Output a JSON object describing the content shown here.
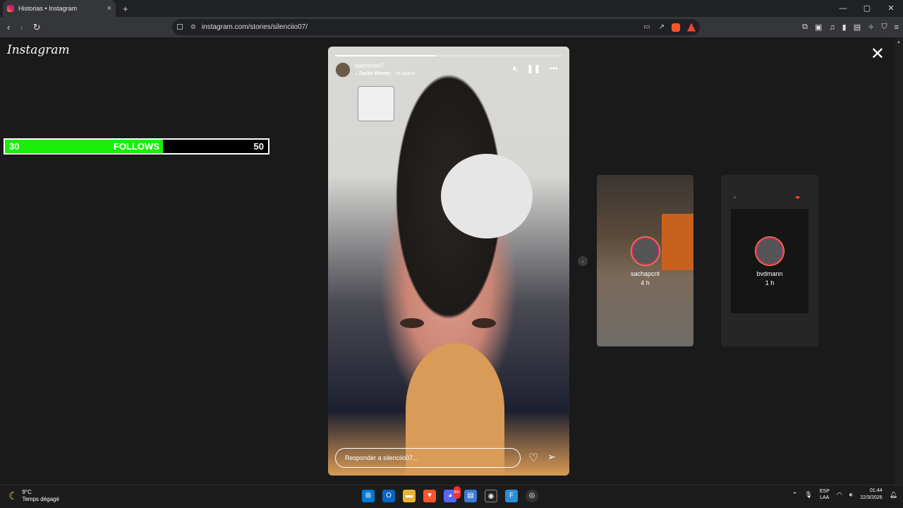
{
  "browser": {
    "tab_title": "Historias • Instagram",
    "tab_close": "×",
    "new_tab": "+",
    "window_controls": [
      "—",
      "▢",
      "✕"
    ],
    "url": "instagram.com/stories/silenciio07/",
    "nav_icons": [
      "back-icon",
      "forward-icon",
      "reload-icon"
    ]
  },
  "page": {
    "logo": "Instagram",
    "close": "✕"
  },
  "follows_bar": {
    "current": "30",
    "label": "FOLLOWS",
    "goal": "50",
    "progress_fraction": 0.6,
    "fill_color": "#18f00a"
  },
  "story": {
    "username": "silenciio07",
    "time": "2 h",
    "music_artist": "Zachz Winner",
    "music_song": "no space",
    "music_separator": " · ",
    "progress_fraction": 0.44,
    "reply_placeholder": "Responder a silenciio07..."
  },
  "previews": [
    {
      "username": "sachapcnt",
      "time": "4 h"
    },
    {
      "username": "bvdmann",
      "time": "1 h"
    }
  ],
  "taskbar": {
    "temperature": "9°C",
    "weather": "Temps dégagé",
    "lang1": "ESP",
    "lang2": "LAA",
    "time": "01:44",
    "date": "22/3/2026",
    "discord_badge": "99+"
  }
}
